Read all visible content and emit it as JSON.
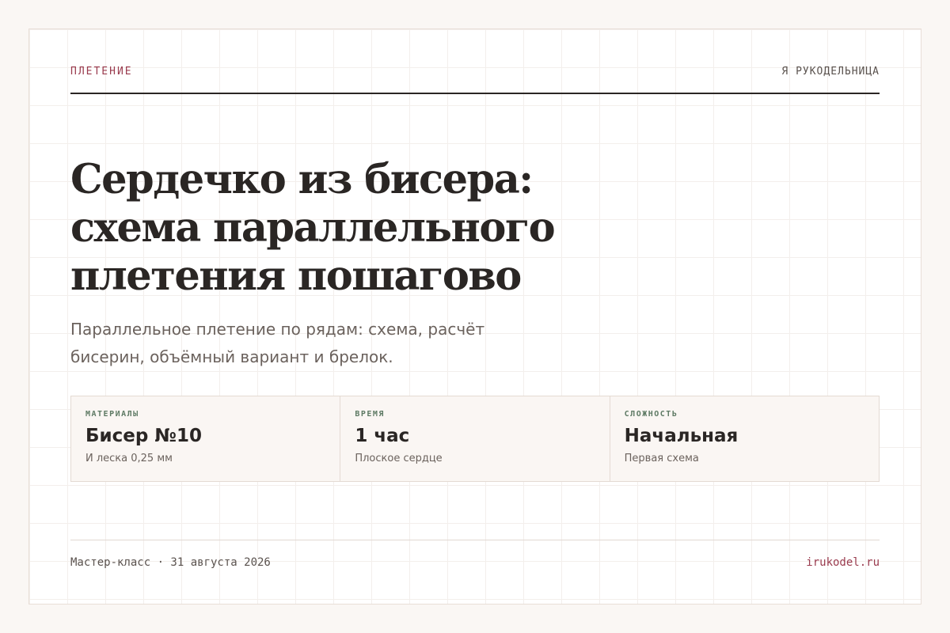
{
  "header": {
    "category": "ПЛЕТЕНИЕ",
    "site_name": "Я РУКОДЕЛЬНИЦА"
  },
  "article": {
    "title_lines": [
      "Сердечко из бисера:",
      "схема параллельного",
      "плетения пошагово"
    ],
    "subtitle_lines": [
      "Параллельное плетение по рядам: схема, расчёт",
      "бисерин, объёмный вариант и брелок."
    ]
  },
  "stats": [
    {
      "label": "МАТЕРИАЛЫ",
      "value": "Бисер №10",
      "note": "И леска 0,25 мм"
    },
    {
      "label": "ВРЕМЯ",
      "value": "1 час",
      "note": "Плоское сердце"
    },
    {
      "label": "СЛОЖНОСТЬ",
      "value": "Начальная",
      "note": "Первая схема"
    }
  ],
  "footer": {
    "meta": "Мастер-класс · 31 августа 2026",
    "domain": "irukodel.ru"
  },
  "colors": {
    "accent": "#9a3b4e",
    "label_green": "#5e7a64",
    "text_dark": "#2a2624",
    "text_muted": "#6b625d"
  }
}
